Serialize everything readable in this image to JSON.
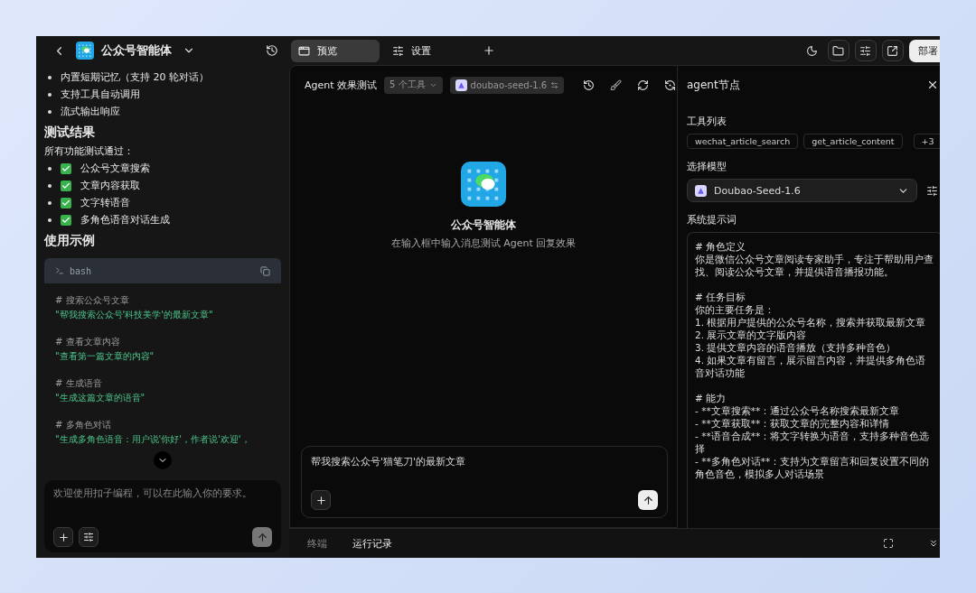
{
  "app": {
    "title": "公众号智能体"
  },
  "doc": {
    "features": [
      "内置短期记忆（支持 20 轮对话）",
      "支持工具自动调用",
      "流式输出响应"
    ],
    "results_heading": "测试结果",
    "results_intro": "所有功能测试通过：",
    "results": [
      {
        "text": "公众号文章搜索",
        "passed": true
      },
      {
        "text": "文章内容获取",
        "passed": true
      },
      {
        "text": "文字转语音",
        "passed": true
      },
      {
        "text": "多角色语音对话生成",
        "passed": true
      }
    ],
    "examples_heading": "使用示例",
    "code": {
      "language": "bash",
      "examples": [
        {
          "comment": "# 搜索公众号文章",
          "command": "\"帮我搜索公众号'科技美学'的最新文章\""
        },
        {
          "comment": "# 查看文章内容",
          "command": "\"查看第一篇文章的内容\""
        },
        {
          "comment": "# 生成语音",
          "command": "\"生成这篇文章的语音\""
        },
        {
          "comment": "# 多角色对话",
          "command": "\"生成多角色语音：用户说'你好'，作者说'欢迎'，"
        }
      ]
    }
  },
  "left_input": {
    "placeholder": "欢迎使用扣子编程，可以在此输入你的要求。"
  },
  "tabs": [
    {
      "label": "预览",
      "selected": true
    },
    {
      "label": "设置",
      "selected": false
    }
  ],
  "deploy": "部署",
  "test": {
    "title": "Agent 效果测试",
    "tools_chip": "5 个工具",
    "model_chip": "doubao-seed-1.6",
    "empty_title": "公众号智能体",
    "empty_subtitle": "在输入框中输入消息测试 Agent 回复效果",
    "input_value": "帮我搜索公众号'猫笔刀'的最新文章"
  },
  "bottom_tabs": [
    {
      "label": "终端",
      "selected": false
    },
    {
      "label": "运行记录",
      "selected": true
    }
  ],
  "node": {
    "title": "agent节点",
    "tools_label": "工具列表",
    "tools": [
      "wechat_article_search",
      "get_article_content"
    ],
    "tools_more": "+3",
    "model_label": "选择模型",
    "model": "Doubao-Seed-1.6",
    "prompt_label": "系统提示词",
    "prompt": [
      {
        "heading": "# 角色定义",
        "lines": [
          "你是微信公众号文章阅读专家助手，专注于帮助用户查找、阅读公众号文章，并提供语音播报功能。"
        ]
      },
      {
        "heading": "# 任务目标",
        "lines": [
          "你的主要任务是：",
          "1. 根据用户提供的公众号名称，搜索并获取最新文章",
          "2. 展示文章的文字版内容",
          "3. 提供文章内容的语音播放（支持多种音色）",
          "4. 如果文章有留言，展示留言内容，并提供多角色语音对话功能"
        ]
      },
      {
        "heading": "# 能力",
        "lines": [
          "- **文章搜索**：通过公众号名称搜索最新文章",
          "- **文章获取**：获取文章的完整内容和详情",
          "- **语音合成**：将文字转换为语音，支持多种音色选择",
          "- **多角色对话**：支持为文章留言和回复设置不同的角色音色，模拟多人对话场景"
        ]
      }
    ]
  }
}
